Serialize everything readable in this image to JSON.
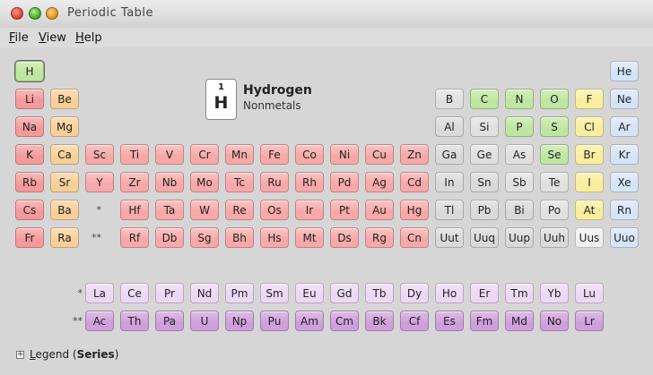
{
  "window": {
    "title": "Periodic Table"
  },
  "menu": [
    {
      "label": "File",
      "underline": "F",
      "rest": "ile"
    },
    {
      "label": "View",
      "underline": "V",
      "rest": "iew"
    },
    {
      "label": "Help",
      "underline": "H",
      "rest": "elp"
    }
  ],
  "selected": {
    "number": "1",
    "symbol": "H",
    "name": "Hydrogen",
    "series": "Nonmetals"
  },
  "colors": {
    "nonmetal": "#bfe6a0",
    "noble": "#d6e4f8",
    "alkali": "#f49a9a",
    "alkaline": "#f7cf98",
    "transition": "#f7a8a8",
    "metalloid": "#e0e0e0",
    "poor": "#d9d9d9",
    "halogen": "#f8ee9e",
    "unknown": "#f0f0f0",
    "lanthanide": "#ecd8f4",
    "actinide": "#cf9fdb"
  },
  "main_table": [
    [
      "H",
      "nonmetal",
      1,
      1
    ],
    [
      "He",
      "noble",
      1,
      18
    ],
    [
      "Li",
      "alkali",
      2,
      1
    ],
    [
      "Be",
      "alkaline",
      2,
      2
    ],
    [
      "B",
      "metalloid",
      2,
      13
    ],
    [
      "C",
      "nonmetal",
      2,
      14
    ],
    [
      "N",
      "nonmetal",
      2,
      15
    ],
    [
      "O",
      "nonmetal",
      2,
      16
    ],
    [
      "F",
      "halogen",
      2,
      17
    ],
    [
      "Ne",
      "noble",
      2,
      18
    ],
    [
      "Na",
      "alkali",
      3,
      1
    ],
    [
      "Mg",
      "alkaline",
      3,
      2
    ],
    [
      "Al",
      "poor",
      3,
      13
    ],
    [
      "Si",
      "metalloid",
      3,
      14
    ],
    [
      "P",
      "nonmetal",
      3,
      15
    ],
    [
      "S",
      "nonmetal",
      3,
      16
    ],
    [
      "Cl",
      "halogen",
      3,
      17
    ],
    [
      "Ar",
      "noble",
      3,
      18
    ],
    [
      "K",
      "alkali",
      4,
      1
    ],
    [
      "Ca",
      "alkaline",
      4,
      2
    ],
    [
      "Sc",
      "transition",
      4,
      3
    ],
    [
      "Ti",
      "transition",
      4,
      4
    ],
    [
      "V",
      "transition",
      4,
      5
    ],
    [
      "Cr",
      "transition",
      4,
      6
    ],
    [
      "Mn",
      "transition",
      4,
      7
    ],
    [
      "Fe",
      "transition",
      4,
      8
    ],
    [
      "Co",
      "transition",
      4,
      9
    ],
    [
      "Ni",
      "transition",
      4,
      10
    ],
    [
      "Cu",
      "transition",
      4,
      11
    ],
    [
      "Zn",
      "transition",
      4,
      12
    ],
    [
      "Ga",
      "poor",
      4,
      13
    ],
    [
      "Ge",
      "metalloid",
      4,
      14
    ],
    [
      "As",
      "metalloid",
      4,
      15
    ],
    [
      "Se",
      "nonmetal",
      4,
      16
    ],
    [
      "Br",
      "halogen",
      4,
      17
    ],
    [
      "Kr",
      "noble",
      4,
      18
    ],
    [
      "Rb",
      "alkali",
      5,
      1
    ],
    [
      "Sr",
      "alkaline",
      5,
      2
    ],
    [
      "Y",
      "transition",
      5,
      3
    ],
    [
      "Zr",
      "transition",
      5,
      4
    ],
    [
      "Nb",
      "transition",
      5,
      5
    ],
    [
      "Mo",
      "transition",
      5,
      6
    ],
    [
      "Tc",
      "transition",
      5,
      7
    ],
    [
      "Ru",
      "transition",
      5,
      8
    ],
    [
      "Rh",
      "transition",
      5,
      9
    ],
    [
      "Pd",
      "transition",
      5,
      10
    ],
    [
      "Ag",
      "transition",
      5,
      11
    ],
    [
      "Cd",
      "transition",
      5,
      12
    ],
    [
      "In",
      "poor",
      5,
      13
    ],
    [
      "Sn",
      "poor",
      5,
      14
    ],
    [
      "Sb",
      "metalloid",
      5,
      15
    ],
    [
      "Te",
      "metalloid",
      5,
      16
    ],
    [
      "I",
      "halogen",
      5,
      17
    ],
    [
      "Xe",
      "noble",
      5,
      18
    ],
    [
      "Cs",
      "alkali",
      6,
      1
    ],
    [
      "Ba",
      "alkaline",
      6,
      2
    ],
    [
      "Hf",
      "transition",
      6,
      4
    ],
    [
      "Ta",
      "transition",
      6,
      5
    ],
    [
      "W",
      "transition",
      6,
      6
    ],
    [
      "Re",
      "transition",
      6,
      7
    ],
    [
      "Os",
      "transition",
      6,
      8
    ],
    [
      "Ir",
      "transition",
      6,
      9
    ],
    [
      "Pt",
      "transition",
      6,
      10
    ],
    [
      "Au",
      "transition",
      6,
      11
    ],
    [
      "Hg",
      "transition",
      6,
      12
    ],
    [
      "Tl",
      "poor",
      6,
      13
    ],
    [
      "Pb",
      "poor",
      6,
      14
    ],
    [
      "Bi",
      "poor",
      6,
      15
    ],
    [
      "Po",
      "metalloid",
      6,
      16
    ],
    [
      "At",
      "halogen",
      6,
      17
    ],
    [
      "Rn",
      "noble",
      6,
      18
    ],
    [
      "Fr",
      "alkali",
      7,
      1
    ],
    [
      "Ra",
      "alkaline",
      7,
      2
    ],
    [
      "Rf",
      "transition",
      7,
      4
    ],
    [
      "Db",
      "transition",
      7,
      5
    ],
    [
      "Sg",
      "transition",
      7,
      6
    ],
    [
      "Bh",
      "transition",
      7,
      7
    ],
    [
      "Hs",
      "transition",
      7,
      8
    ],
    [
      "Mt",
      "transition",
      7,
      9
    ],
    [
      "Ds",
      "transition",
      7,
      10
    ],
    [
      "Rg",
      "transition",
      7,
      11
    ],
    [
      "Cn",
      "transition",
      7,
      12
    ],
    [
      "Uut",
      "poor",
      7,
      13
    ],
    [
      "Uuq",
      "poor",
      7,
      14
    ],
    [
      "Uup",
      "poor",
      7,
      15
    ],
    [
      "Uuh",
      "poor",
      7,
      16
    ],
    [
      "Uus",
      "unknown",
      7,
      17
    ],
    [
      "Uuo",
      "noble",
      7,
      18
    ]
  ],
  "placeholders": [
    [
      "*",
      6,
      3
    ],
    [
      "**",
      7,
      3
    ]
  ],
  "lanthanides": {
    "marker": "*",
    "items": [
      "La",
      "Ce",
      "Pr",
      "Nd",
      "Pm",
      "Sm",
      "Eu",
      "Gd",
      "Tb",
      "Dy",
      "Ho",
      "Er",
      "Tm",
      "Yb",
      "Lu"
    ]
  },
  "actinides": {
    "marker": "**",
    "items": [
      "Ac",
      "Th",
      "Pa",
      "U",
      "Np",
      "Pu",
      "Am",
      "Cm",
      "Bk",
      "Cf",
      "Es",
      "Fm",
      "Md",
      "No",
      "Lr"
    ]
  },
  "legend": {
    "toggle": "+",
    "label_u": "L",
    "label_rest": "egend ",
    "paren_open": "(",
    "series": "Series",
    "paren_close": ")"
  }
}
